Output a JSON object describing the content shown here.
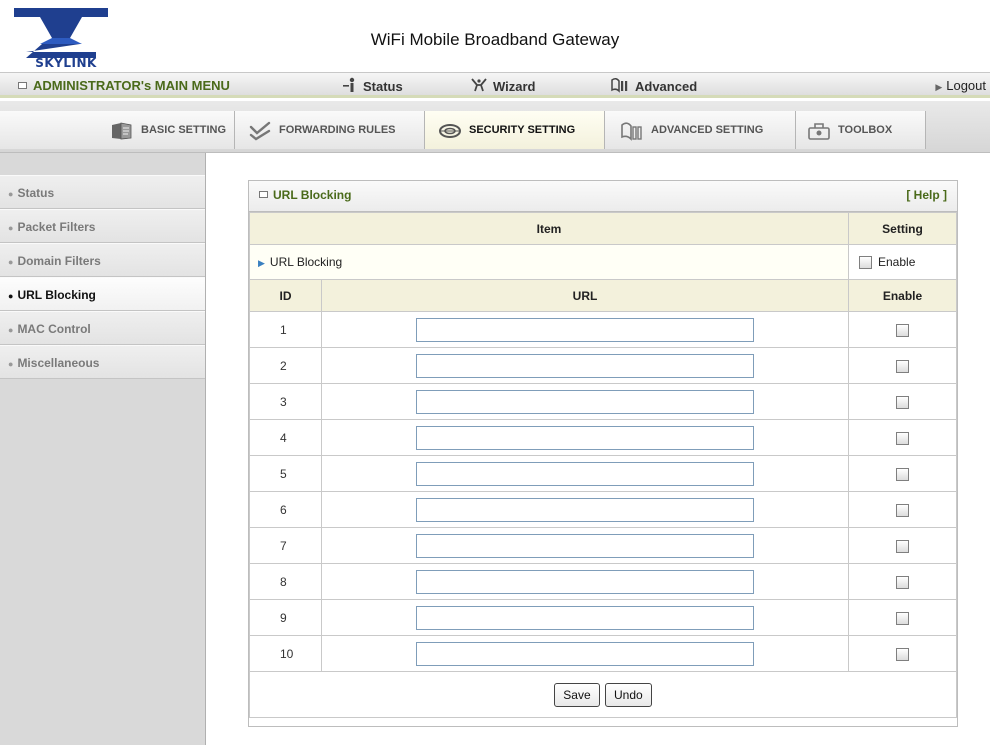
{
  "header": {
    "logo_text": "SKYLINK",
    "title": "WiFi Mobile Broadband Gateway"
  },
  "main_menu": {
    "admin_label": "ADMINISTRATOR's MAIN MENU",
    "items": [
      {
        "label": "Status",
        "icon": "status-person-icon"
      },
      {
        "label": "Wizard",
        "icon": "wizard-icon"
      },
      {
        "label": "Advanced",
        "icon": "advanced-icon"
      }
    ],
    "logout_label": "Logout"
  },
  "tabs": [
    {
      "label": "BASIC SETTING",
      "icon": "basic-setting-icon",
      "active": false
    },
    {
      "label": "FORWARDING RULES",
      "icon": "forwarding-rules-icon",
      "active": false
    },
    {
      "label": "SECURITY SETTING",
      "icon": "security-setting-icon",
      "active": true
    },
    {
      "label": "ADVANCED SETTING",
      "icon": "advanced-setting-icon",
      "active": false
    },
    {
      "label": "TOOLBOX",
      "icon": "toolbox-icon",
      "active": false
    }
  ],
  "sidebar": {
    "items": [
      {
        "label": "Status",
        "active": false
      },
      {
        "label": "Packet Filters",
        "active": false
      },
      {
        "label": "Domain Filters",
        "active": false
      },
      {
        "label": "URL Blocking",
        "active": true
      },
      {
        "label": "MAC Control",
        "active": false
      },
      {
        "label": "Miscellaneous",
        "active": false
      }
    ]
  },
  "panel": {
    "title": "URL Blocking",
    "help_label": "[ Help ]",
    "col_item": "Item",
    "col_setting": "Setting",
    "main_row": {
      "item": "URL Blocking",
      "setting_label": "Enable",
      "checked": false
    },
    "url_table": {
      "col_id": "ID",
      "col_url": "URL",
      "col_enable": "Enable",
      "rows": [
        {
          "id": "1",
          "url": "",
          "enabled": false
        },
        {
          "id": "2",
          "url": "",
          "enabled": false
        },
        {
          "id": "3",
          "url": "",
          "enabled": false
        },
        {
          "id": "4",
          "url": "",
          "enabled": false
        },
        {
          "id": "5",
          "url": "",
          "enabled": false
        },
        {
          "id": "6",
          "url": "",
          "enabled": false
        },
        {
          "id": "7",
          "url": "",
          "enabled": false
        },
        {
          "id": "8",
          "url": "",
          "enabled": false
        },
        {
          "id": "9",
          "url": "",
          "enabled": false
        },
        {
          "id": "10",
          "url": "",
          "enabled": false
        }
      ]
    },
    "save_label": "Save",
    "undo_label": "Undo"
  },
  "colors": {
    "accent_green": "#4a6a1a",
    "header_cell_bg": "#f3f1dc",
    "logo_blue": "#1f3f8f"
  }
}
